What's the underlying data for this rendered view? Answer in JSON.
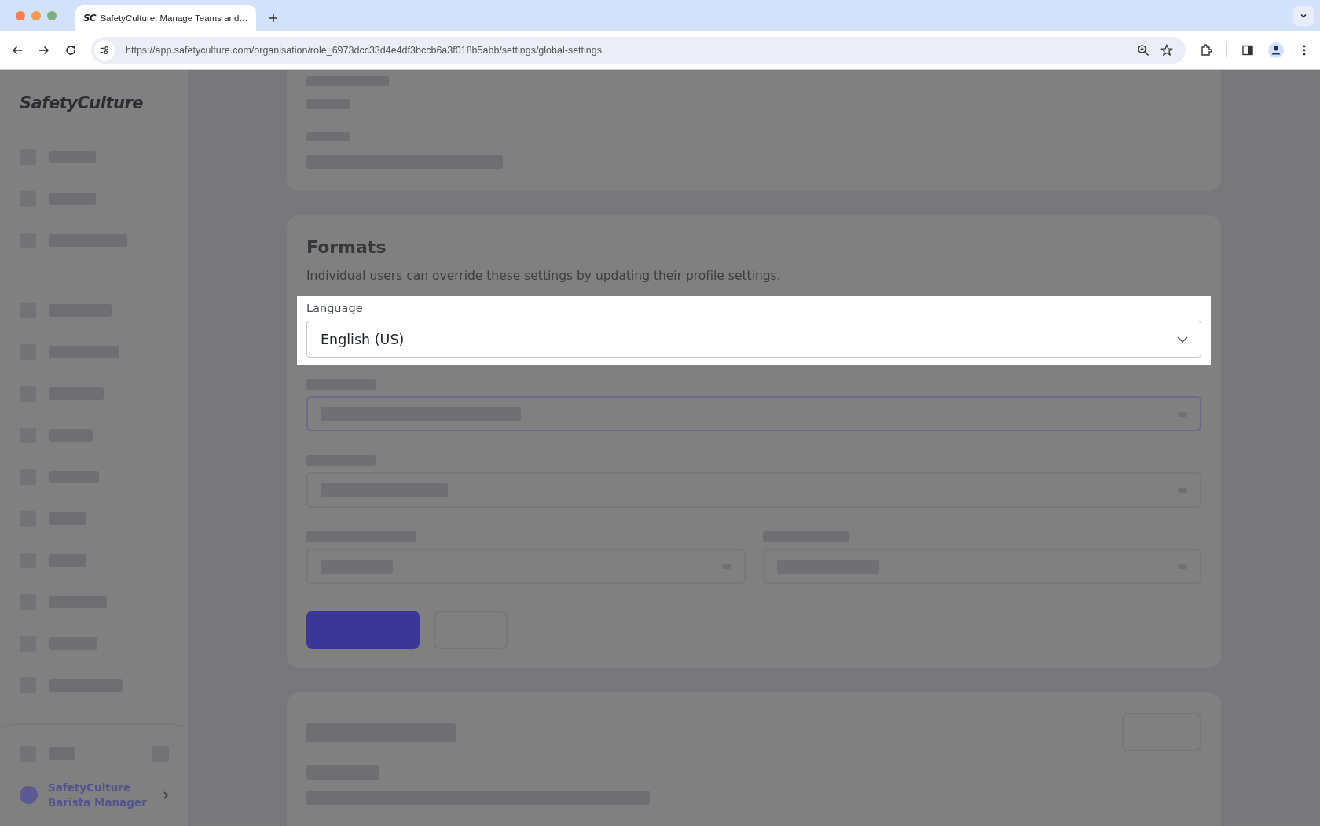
{
  "browser": {
    "tabs": [
      {
        "favicon": "SC",
        "title": "SafetyCulture: Manage Teams and…",
        "selected": true
      }
    ],
    "address": "https://app.safetyculture.com/organisation/role_6973dcc33d4e4df3bccb6a3f018b5abb/settings/global-settings"
  },
  "sidebar": {
    "logo": "SafetyCulture",
    "account": {
      "name": "SafetyCulture",
      "role": "Barista Manager"
    }
  },
  "formats": {
    "title": "Formats",
    "description": "Individual users can override these settings by updating their profile settings.",
    "language": {
      "label": "Language",
      "value": "English (US)"
    }
  }
}
